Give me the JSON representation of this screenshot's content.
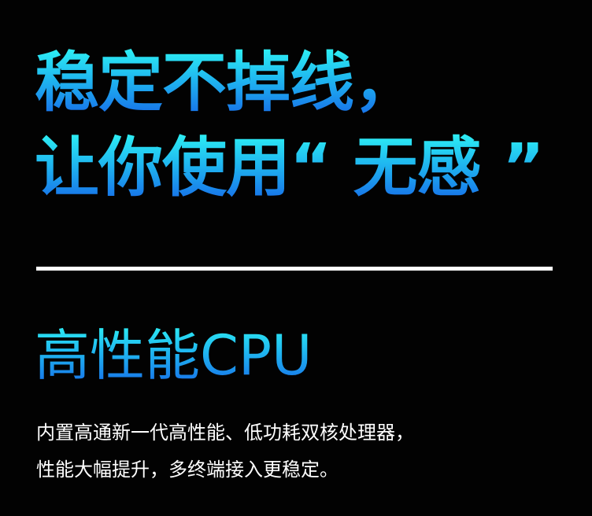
{
  "headline": {
    "line1": "稳定不掉线，",
    "line2": "让你使用“ 无感 ”"
  },
  "section": {
    "title": "高性能CPU",
    "description_line1": "内置高通新一代高性能、低功耗双核处理器，",
    "description_line2": "性能大幅提升，多终端接入更稳定。"
  },
  "colors": {
    "background": "#020202",
    "gradient_top": "#2ef2f4",
    "gradient_bottom": "#1668e8",
    "divider": "#ffffff",
    "body_text": "#ffffff"
  }
}
